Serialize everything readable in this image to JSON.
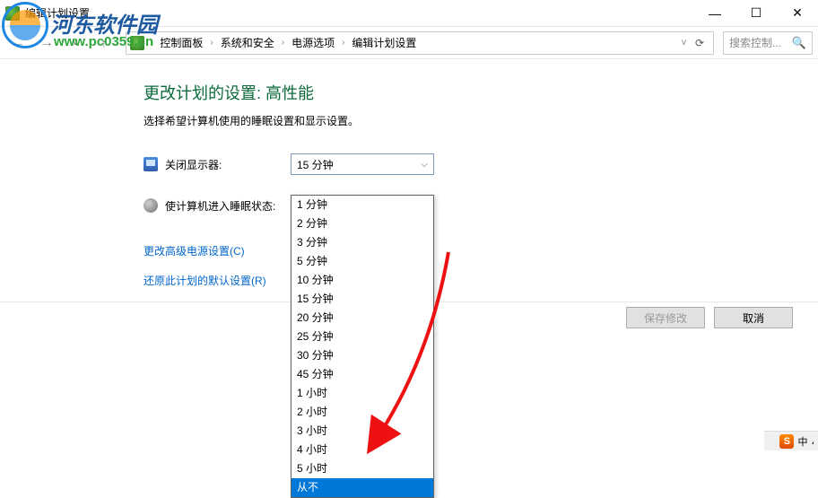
{
  "window": {
    "title": "编辑计划设置",
    "min": "—",
    "max": "☐",
    "close": "✕"
  },
  "nav": {
    "back": "←",
    "forward": "→",
    "up": "↑",
    "refresh": "⟳",
    "dropdown": "v"
  },
  "breadcrumb": {
    "items": [
      "控制面板",
      "系统和安全",
      "电源选项",
      "编辑计划设置"
    ],
    "sep": "›"
  },
  "search": {
    "placeholder": "搜索控制...",
    "icon": "🔍"
  },
  "page": {
    "title": "更改计划的设置: 高性能",
    "desc": "选择希望计算机使用的睡眠设置和显示设置。"
  },
  "settings": {
    "display_off": {
      "label": "关闭显示器:",
      "value": "15 分钟"
    },
    "sleep": {
      "label": "使计算机进入睡眠状态:",
      "value": "从不"
    }
  },
  "dropdown_options": [
    "1 分钟",
    "2 分钟",
    "3 分钟",
    "5 分钟",
    "10 分钟",
    "15 分钟",
    "20 分钟",
    "25 分钟",
    "30 分钟",
    "45 分钟",
    "1 小时",
    "2 小时",
    "3 小时",
    "4 小时",
    "5 小时",
    "从不"
  ],
  "dropdown_selected_index": 15,
  "links": {
    "advanced": "更改高级电源设置(C)",
    "restore": "还原此计划的默认设置(R)"
  },
  "buttons": {
    "save": "保存修改",
    "cancel": "取消"
  },
  "watermark": {
    "name": "河东软件园",
    "url": "www.pc0359.cn"
  },
  "taskbar": {
    "ime": "中",
    "s": "S"
  }
}
